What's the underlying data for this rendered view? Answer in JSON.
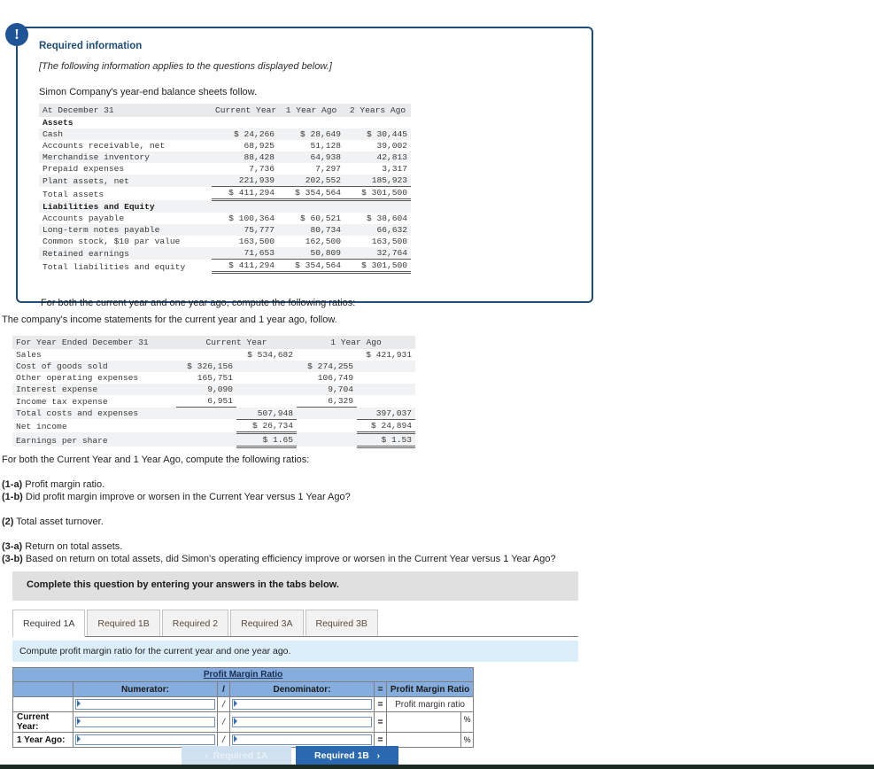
{
  "required_info": {
    "icon": "exclamation-icon",
    "title": "Required information",
    "note": "[The following information applies to the questions displayed below.]",
    "lead": "Simon Company's year-end balance sheets follow.",
    "footer": "For both the current year and one year ago, compute the following ratios:"
  },
  "balance_sheet": {
    "columns": [
      "At December 31",
      "Current Year",
      "1 Year Ago",
      "2 Years Ago"
    ],
    "rows": [
      {
        "label": "Assets",
        "type": "section",
        "values": [
          "",
          "",
          ""
        ]
      },
      {
        "label": "Cash",
        "type": "data",
        "values": [
          "$ 24,266",
          "$ 28,649",
          "$ 30,445"
        ]
      },
      {
        "label": "Accounts receivable, net",
        "type": "data",
        "values": [
          "68,925",
          "51,128",
          "39,002"
        ]
      },
      {
        "label": "Merchandise inventory",
        "type": "data",
        "values": [
          "88,428",
          "64,938",
          "42,813"
        ]
      },
      {
        "label": "Prepaid expenses",
        "type": "data",
        "values": [
          "7,736",
          "7,297",
          "3,317"
        ]
      },
      {
        "label": "Plant assets, net",
        "type": "data",
        "values": [
          "221,939",
          "202,552",
          "185,923"
        ]
      },
      {
        "label": "Total assets",
        "type": "total",
        "values": [
          "$ 411,294",
          "$ 354,564",
          "$ 301,500"
        ]
      },
      {
        "label": "Liabilities and Equity",
        "type": "section",
        "values": [
          "",
          "",
          ""
        ]
      },
      {
        "label": "Accounts payable",
        "type": "data",
        "values": [
          "$ 100,364",
          "$ 60,521",
          "$ 38,604"
        ]
      },
      {
        "label": "Long-term notes payable",
        "type": "data",
        "values": [
          "75,777",
          "80,734",
          "66,632"
        ]
      },
      {
        "label": "Common stock, $10 par value",
        "type": "data",
        "values": [
          "163,500",
          "162,500",
          "163,500"
        ]
      },
      {
        "label": "Retained earnings",
        "type": "data",
        "values": [
          "71,653",
          "50,809",
          "32,764"
        ]
      },
      {
        "label": "Total liabilities and equity",
        "type": "total",
        "values": [
          "$ 411,294",
          "$ 354,564",
          "$ 301,500"
        ]
      }
    ]
  },
  "income_lead": "The company's income statements for the current year and 1 year ago, follow.",
  "income_statement": {
    "columns": [
      "For Year Ended December 31",
      "Current Year",
      "1 Year Ago"
    ],
    "rows": [
      {
        "label": "Sales",
        "cy_sub": "",
        "cy": "$ 534,682",
        "py_sub": "",
        "py": "$ 421,931"
      },
      {
        "label": "Cost of goods sold",
        "cy_sub": "$ 326,156",
        "cy": "",
        "py_sub": "$ 274,255",
        "py": ""
      },
      {
        "label": "Other operating expenses",
        "cy_sub": "165,751",
        "cy": "",
        "py_sub": "106,749",
        "py": ""
      },
      {
        "label": "Interest expense",
        "cy_sub": "9,090",
        "cy": "",
        "py_sub": "9,704",
        "py": ""
      },
      {
        "label": "Income tax expense",
        "cy_sub": "6,951",
        "cy": "",
        "py_sub": "6,329",
        "py": ""
      },
      {
        "label": "Total costs and expenses",
        "cy_sub": "",
        "cy": "507,948",
        "py_sub": "",
        "py": "397,037"
      },
      {
        "label": "Net income",
        "cy_sub": "",
        "cy": "$ 26,734",
        "py_sub": "",
        "py": "$ 24,894"
      },
      {
        "label": "Earnings per share",
        "cy_sub": "",
        "cy": "$ 1.65",
        "py_sub": "",
        "py": "$ 1.53"
      }
    ]
  },
  "requirements": {
    "intro": "For both the Current Year and 1 Year Ago, compute the following ratios:",
    "items": [
      {
        "num": "(1-a)",
        "text": " Profit margin ratio."
      },
      {
        "num": "(1-b)",
        "text": " Did profit margin improve or worsen in the Current Year versus 1 Year Ago?"
      },
      {
        "num": "(2)",
        "text": " Total asset turnover."
      },
      {
        "num": "(3-a)",
        "text": " Return on total assets."
      },
      {
        "num": "(3-b)",
        "text": " Based on return on total assets, did Simon's operating efficiency improve or worsen in the Current Year versus 1 Year Ago?"
      }
    ]
  },
  "complete_bar": "Complete this question by entering your answers in the tabs below.",
  "tabs": [
    {
      "label": "Required 1A",
      "active": true
    },
    {
      "label": "Required 1B",
      "active": false
    },
    {
      "label": "Required 2",
      "active": false
    },
    {
      "label": "Required 3A",
      "active": false
    },
    {
      "label": "Required 3B",
      "active": false
    }
  ],
  "tab_instruction": "Compute profit margin ratio for the current year and one year ago.",
  "answer_grid": {
    "title": "Profit Margin Ratio",
    "headers": {
      "rowlabel": "",
      "numerator": "Numerator:",
      "slash": "/",
      "denominator": "Denominator:",
      "equals": "=",
      "result": "Profit Margin Ratio"
    },
    "rows": [
      {
        "label": "",
        "numerator": "",
        "slash": "/",
        "denominator": "",
        "equals": "=",
        "result": "Profit margin ratio",
        "result_static": true,
        "percent": false
      },
      {
        "label": "Current Year:",
        "numerator": "",
        "slash": "/",
        "denominator": "",
        "equals": "=",
        "result": "",
        "result_static": false,
        "percent": true,
        "percent_symbol": "%"
      },
      {
        "label": "1 Year Ago:",
        "numerator": "",
        "slash": "/",
        "denominator": "",
        "equals": "=",
        "result": "",
        "result_static": false,
        "percent": true,
        "percent_symbol": "%"
      }
    ]
  },
  "nav": {
    "prev_chevron": "‹",
    "prev_label": "Required 1A",
    "next_label": "Required 1B",
    "next_chevron": "›"
  },
  "colors": {
    "callout_border": "#1f4e79",
    "accent_blue": "#2a68b0",
    "grid_header": "#85aede",
    "instruction_strip": "#ddeefb"
  }
}
